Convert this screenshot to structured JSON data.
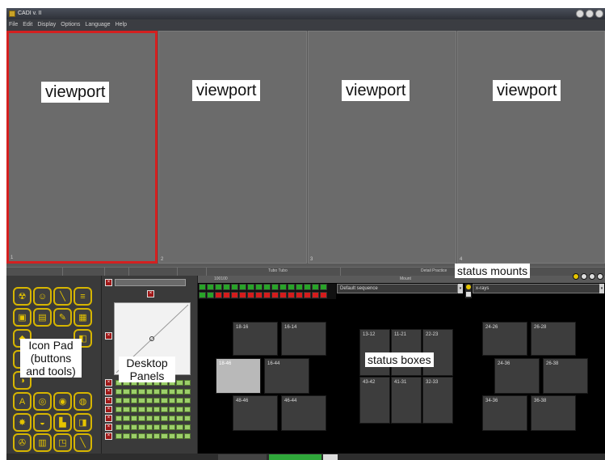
{
  "window": {
    "title": "CADI v. II"
  },
  "menu": [
    "File",
    "Edit",
    "Display",
    "Options",
    "Language",
    "Help"
  ],
  "viewports": [
    {
      "label": "viewport",
      "number": "1"
    },
    {
      "label": "viewport",
      "number": "2"
    },
    {
      "label": "viewport",
      "number": "3"
    },
    {
      "label": "viewport",
      "number": "4"
    }
  ],
  "status_strip": {
    "left_text": "Tubo Tubo",
    "right_text": "Detail Practice"
  },
  "sequence_header": {
    "left_text": "100100",
    "right_text": "Mount"
  },
  "sequence_dropdown": {
    "value": "Default sequence"
  },
  "xray_dropdown": {
    "value": "x-rays"
  },
  "status_boxes": {
    "group1": [
      "18-16",
      "16-14",
      "18-46",
      "16-44",
      "48-46",
      "46-44"
    ],
    "group2": [
      "13-12",
      "11-21",
      "22-23",
      "43-42",
      "41-31",
      "32-33"
    ],
    "group3": [
      "24-26",
      "26-28",
      "24-36",
      "26-38",
      "34-36",
      "36-38"
    ]
  },
  "callouts": {
    "status_mounts": "status mounts",
    "icon_pad": [
      "Icon Pad",
      "(buttons",
      "and tools)"
    ],
    "desktop_panels": [
      "Desktop",
      "Panels"
    ],
    "status_boxes": "status boxes"
  },
  "colors": {
    "active_viewport_border": "#d42020",
    "icon_yellow": "#d6b500",
    "grid_red": "#d41c1c",
    "grid_green": "#29a329"
  }
}
